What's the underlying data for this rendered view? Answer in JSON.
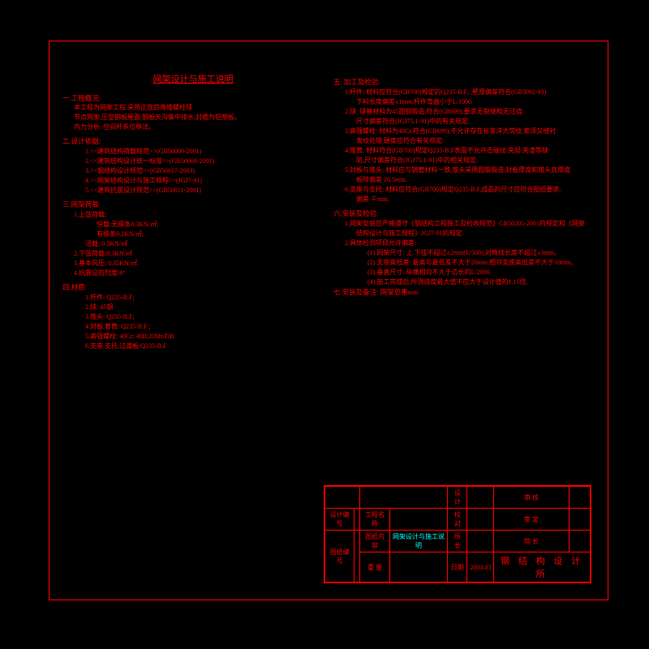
{
  "title": "网架设计与施工说明",
  "s1": {
    "h": "一.工程概况:",
    "l1": "本工程为网架工程,采用正放四角锥螺栓球",
    "l2": "节点网架,压型钢板屋面,钢板天沟集中排水,封檐为铝塑板。",
    "l3": "内力分析: 空间杆系位移法。"
  },
  "s2": {
    "h": "二.设计依据:",
    "i1": "1.<<建筑结构荷载规范>>(GB50009-2001)",
    "i2": "2.<<建筑结构设计统一标准>>(GB50068-2001)",
    "i3": "3.<<钢结构设计规范>>(GB50017-2003)",
    "i4": "4.<<网架结构设计与施工规程>>(JGJ7-91)",
    "i5": "5.<<建筑抗震设计规范>>(GB50011-2001)"
  },
  "s3": {
    "h": "三.网架荷载:",
    "l1": "1.上弦荷载:",
    "l2": "恒载:无檩条0.3KN/㎡;",
    "l3": "有檩条0.2KN/㎡;",
    "l4": "活载: 0.5KN/㎡",
    "l5": "2.下弦荷载:0.3KN/㎡",
    "l6": "3.基本风压: 0.35KN/㎡.",
    "l7": "4.抗震设防烈度:8°"
  },
  "s4": {
    "h": "四.材质:",
    "i1": "1.杆件:  Q235-B.F;",
    "i2": "2.球: 45钢",
    "i3": "3.锥头:  Q235-B.F;",
    "i4": "4.封板.套筒:  Q235-B.F  ;",
    "i5": "5.高强螺栓:  40Cr; 40B;20MnTiB",
    "i6": "6.支座.支托.过渡板:Q235-B.F"
  },
  "s5": {
    "h": "五. 加工及检验:",
    "i1": "1.杆件: 材料应符合(GB700)规定的Q235-B.F; ,壁厚偏差符合(GB3092-93)",
    "i1b": "下料长度偏差±1mm,杆件弯曲小于L/1000.",
    "i2": "2.球: 球基材料为45圆钢锻造,符合(GB699),要求无裂缝和无过烧.",
    "i2b": "尺寸偏差符合(JGJ75.1-91)中的有关规定.",
    "i3": "3.高强螺栓: 材料为40Cr,符合(GB699),不允许存在标准洋大荧纹,索须又缝衬",
    "i3b": "发纹处理,硬度应符合有关规定.",
    "i4": "4.锥筒: 材料符合(GB700)规定Q235-B.F表面不允许击碰纹.夹层.夹渣等缺",
    "i4b": "陷,尺寸偏差符合(JGJ75.1-91)中的相关规定.",
    "i5": "5.封板与锥头: 材料应与钢管材料一致,锥头采用圆锻锻造,封板厚度和锥头底厚度",
    "i5b": "板除偏差 20.5mm.",
    "i6": "6.支座与支托: 材料应符合(GB700)规定Q235-B.F,成品的尺寸应符合图纸要求.",
    "i6b": "偏差 ∓mm."
  },
  "s6": {
    "h": "六.安装及检验:",
    "i1": "1.网架安装应严格遵守《钢结构工程施工及检收规范》GB50205-2001的规定和《网架",
    "i1b": "结构设计与施工规程》JGJ7-91的规定.",
    "i2": "2.具体检测项目允许偏差:",
    "a": "(1).网架尺寸: 上.下弦不超过±2mm(L/500),对角线长度不超过±3mm。",
    "b": "(2).支座高低差: 最高与最低差不大于20mm,相邻支座高低差不大于10mm。",
    "c": "(3).垂直尺寸: 纵横相均不大于边长的L/2000.",
    "d": "(4).施工完成后,所测挠度最大值不应大于设计值的1.15倍."
  },
  "s7": {
    "h": "七.安装及备注:  网架总重mm"
  },
  "tb": {
    "r1a": "设 计",
    "r1b": "审 核",
    "r2a": "设计编号",
    "r2b": "工程名称",
    "r2c": "校 对",
    "r2d": "审 定",
    "r3a": "图纸编号",
    "r3b": "图纸内容",
    "r3c": "网架设计与施工说明",
    "r3d": "所 长",
    "r3e": "院 长",
    "r4a": "重 量",
    "r4b": "日期",
    "r4c": "2004.03",
    "org": "钢 结 构 设 计 所"
  }
}
